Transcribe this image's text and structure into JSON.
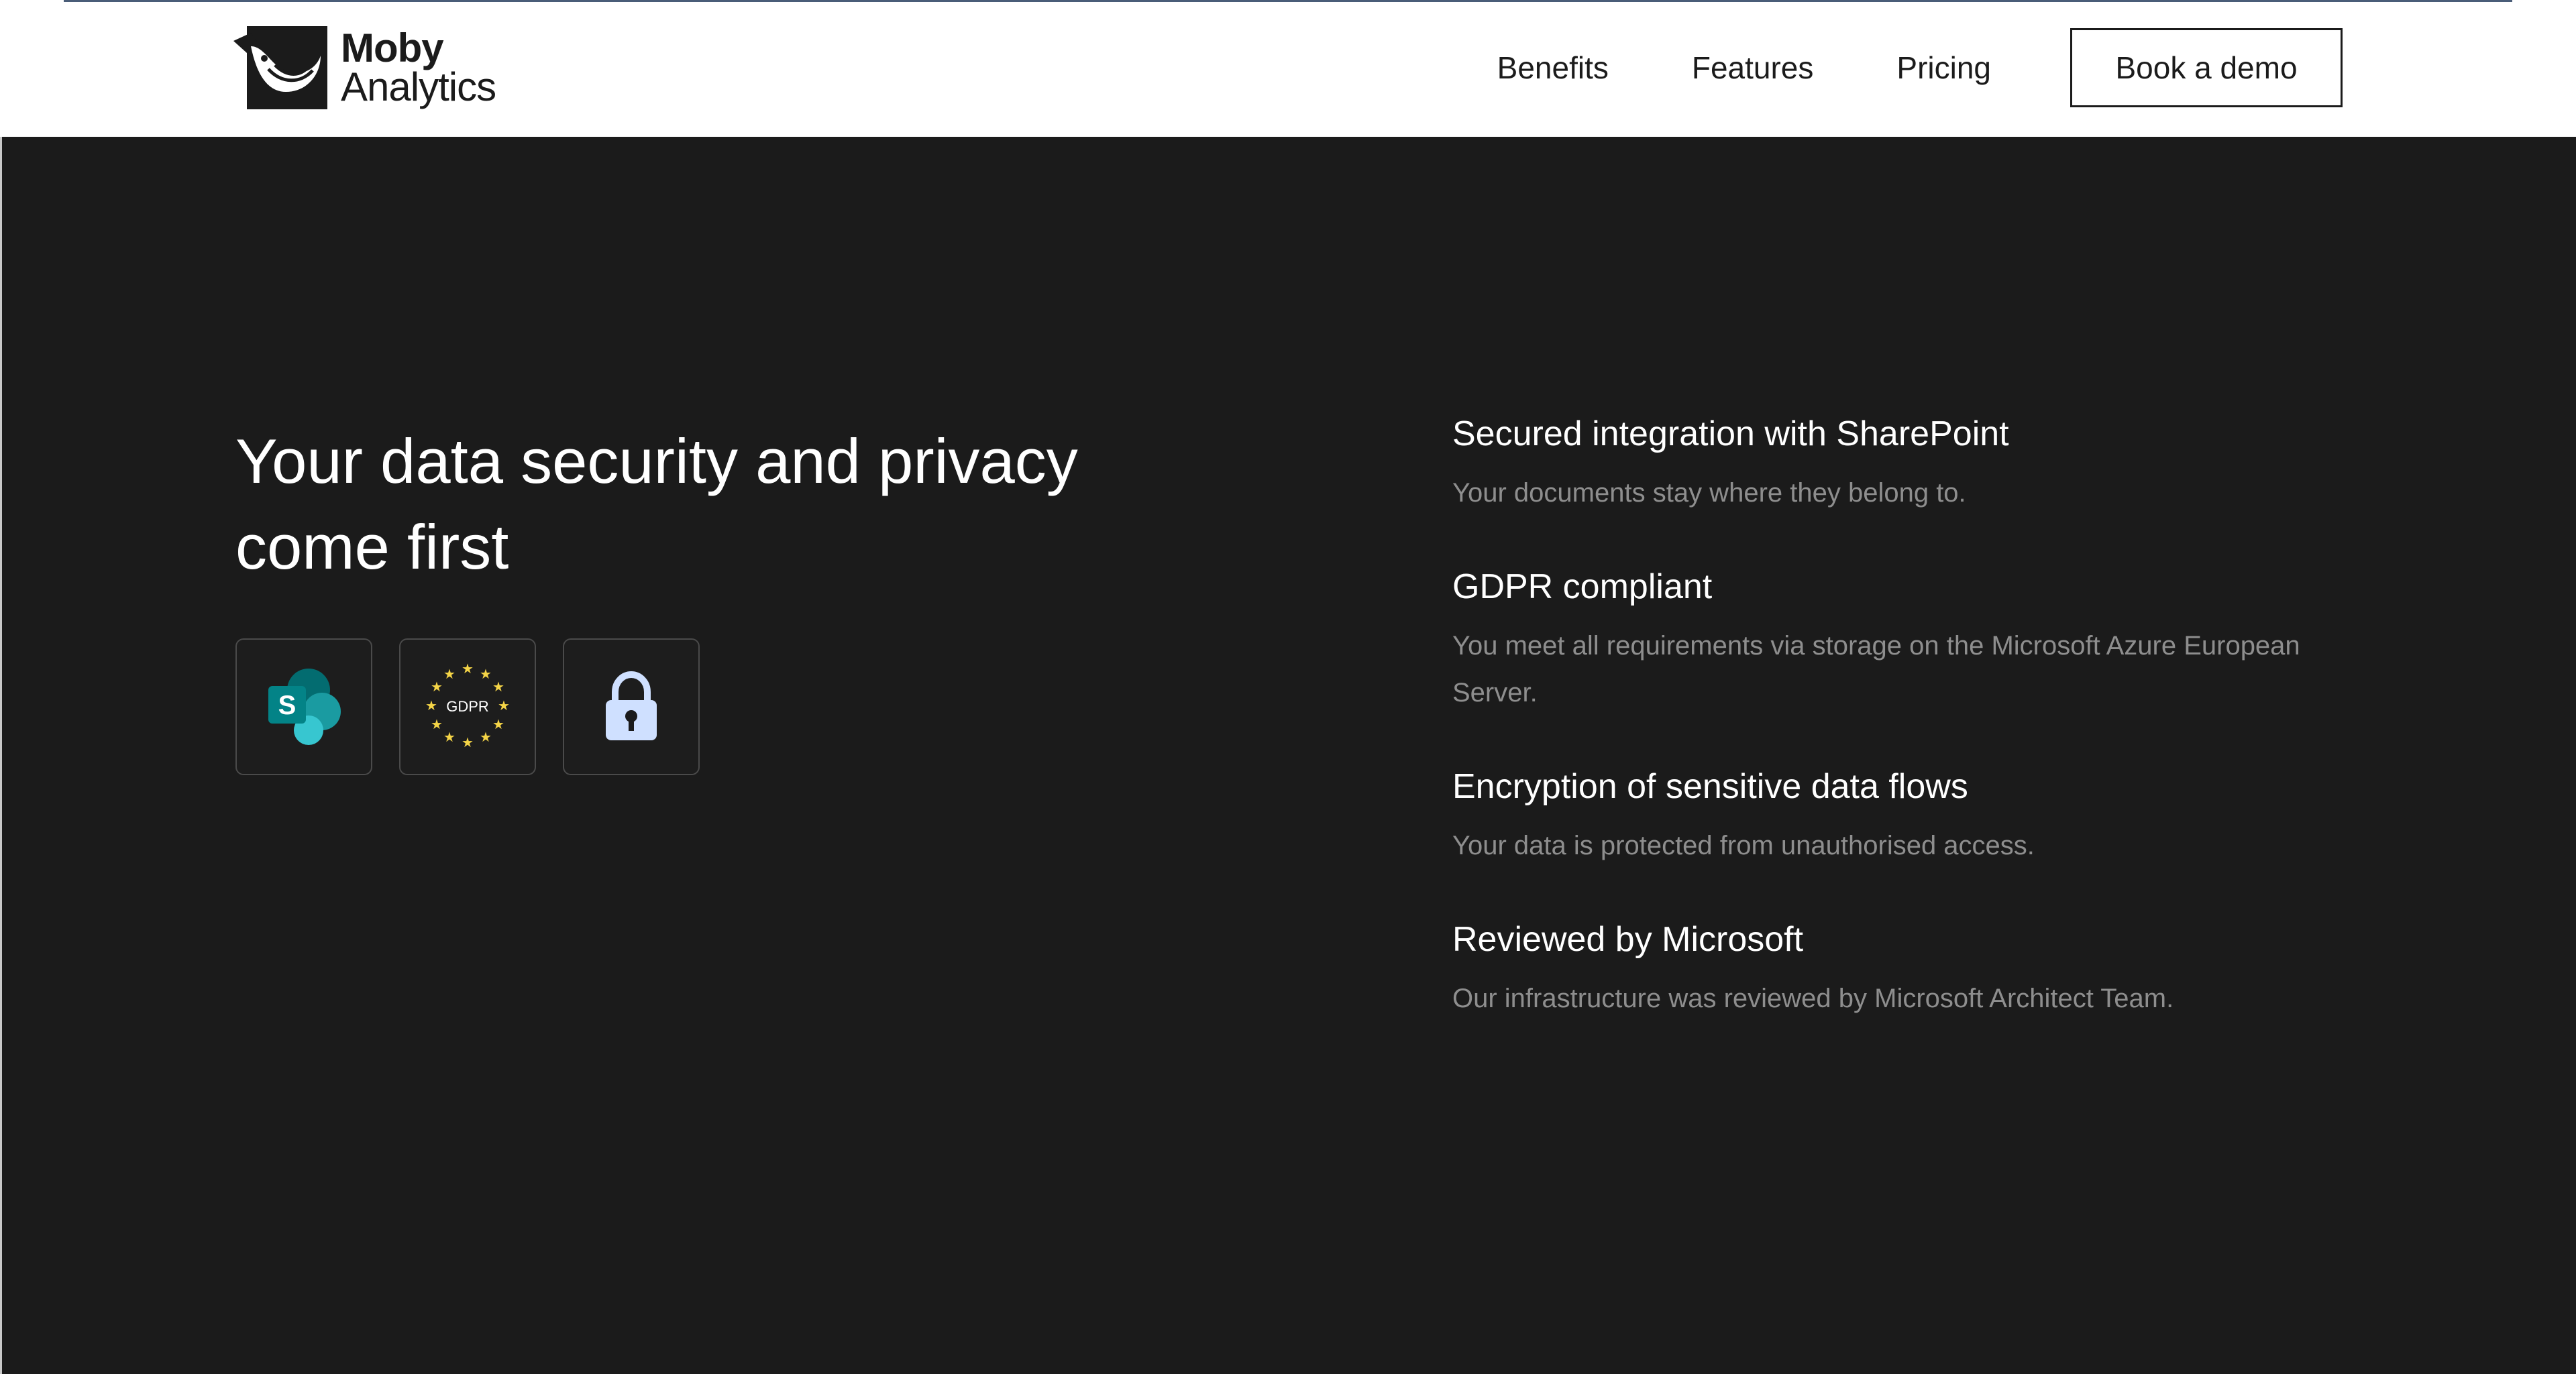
{
  "brand": {
    "name_line1": "Moby",
    "name_line2": "Analytics",
    "logo_icon": "whale-icon"
  },
  "nav": {
    "items": [
      {
        "label": "Benefits"
      },
      {
        "label": "Features"
      },
      {
        "label": "Pricing"
      }
    ],
    "cta_label": "Book a demo"
  },
  "hero": {
    "title": "Your data security and privacy come first",
    "badges": [
      {
        "icon": "sharepoint-icon",
        "text": "S"
      },
      {
        "icon": "gdpr-icon",
        "text": "GDPR"
      },
      {
        "icon": "lock-icon"
      }
    ]
  },
  "features": [
    {
      "title": "Secured integration with SharePoint",
      "description": "Your documents stay where they belong to."
    },
    {
      "title": "GDPR compliant",
      "description": "You meet all requirements via storage on the Microsoft Azure European Server."
    },
    {
      "title": "Encryption of sensitive data flows",
      "description": "Your data is protected from unauthorised access."
    },
    {
      "title": "Reviewed by Microsoft",
      "description": "Our infrastructure was reviewed by Microsoft Architect Team."
    }
  ],
  "colors": {
    "background_dark": "#1b1b1b",
    "text_primary": "#ffffff",
    "text_muted": "#8e8e8e",
    "sharepoint_teal": "#038387",
    "gdpr_star": "#f5d547",
    "lock_blue": "#cfe0ff"
  }
}
